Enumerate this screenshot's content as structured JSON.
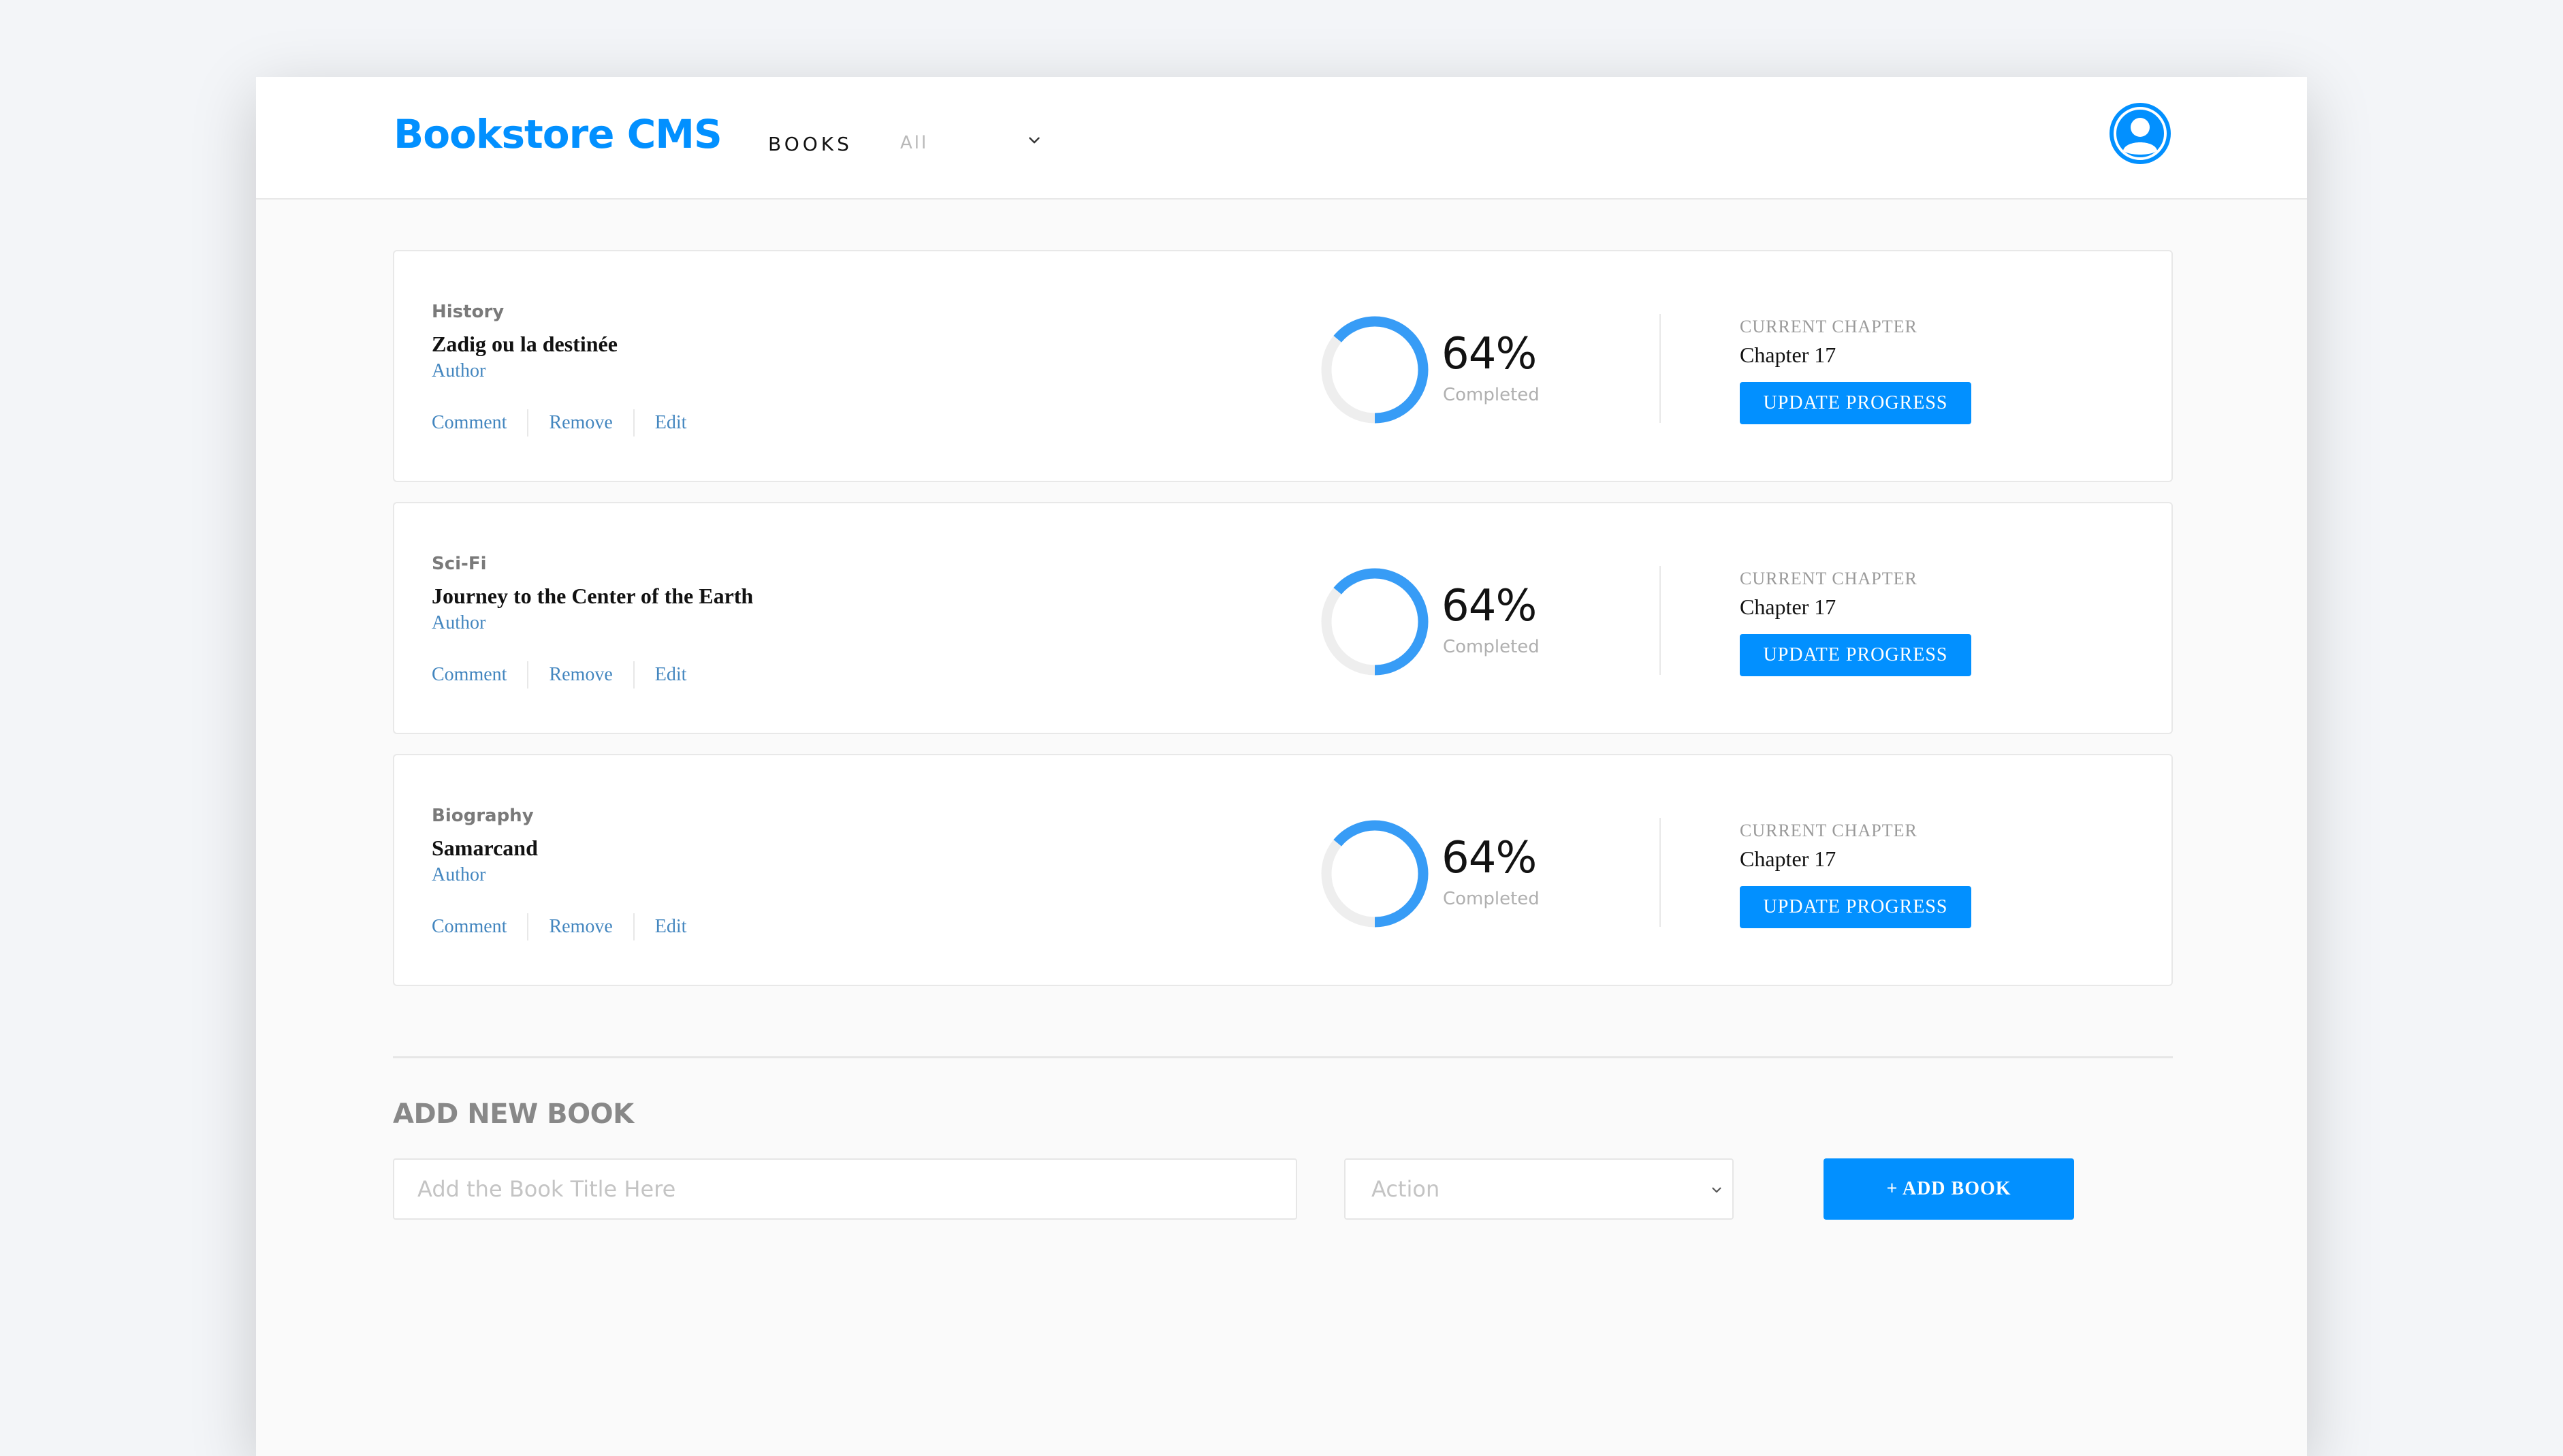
{
  "app": {
    "brand": "Bookstore CMS",
    "nav": {
      "books_label": "BOOKS",
      "filter_value": "All"
    }
  },
  "books": [
    {
      "category": "History",
      "title": "Zadig ou la destinée",
      "author": "Author",
      "actions": [
        "Comment",
        "Remove",
        "Edit"
      ],
      "progress_percent": 64,
      "progress_label": "64%",
      "completed_label": "Completed",
      "current_chapter_label": "CURRENT CHAPTER",
      "current_chapter": "Chapter 17",
      "update_label": "UPDATE PROGRESS"
    },
    {
      "category": "Sci-Fi",
      "title": "Journey to the Center of the Earth",
      "author": "Author",
      "actions": [
        "Comment",
        "Remove",
        "Edit"
      ],
      "progress_percent": 64,
      "progress_label": "64%",
      "completed_label": "Completed",
      "current_chapter_label": "CURRENT CHAPTER",
      "current_chapter": "Chapter 17",
      "update_label": "UPDATE PROGRESS"
    },
    {
      "category": "Biography",
      "title": "Samarcand",
      "author": "Author",
      "actions": [
        "Comment",
        "Remove",
        "Edit"
      ],
      "progress_percent": 64,
      "progress_label": "64%",
      "completed_label": "Completed",
      "current_chapter_label": "CURRENT CHAPTER",
      "current_chapter": "Chapter 17",
      "update_label": "UPDATE PROGRESS"
    }
  ],
  "add_form": {
    "heading": "ADD NEW BOOK",
    "title_placeholder": "Add the Book Title Here",
    "title_value": "",
    "category_selected": "Action",
    "submit_label": "+ ADD BOOK"
  },
  "colors": {
    "accent": "#0290ff",
    "link": "#4386bf",
    "ring_track": "#eeeeee",
    "ring_fill": "#379cf6"
  },
  "icons": {
    "user": "user-circle-icon",
    "chevron": "chevron-down-icon"
  }
}
